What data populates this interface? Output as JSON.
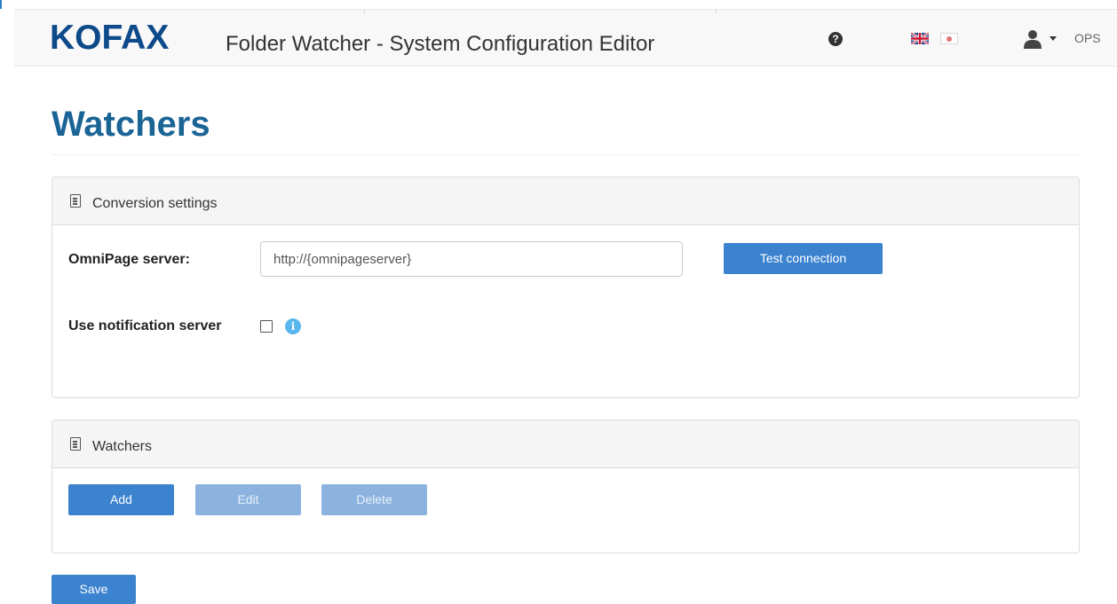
{
  "header": {
    "logo_text": "KOFAX",
    "app_title": "Folder Watcher - System Configuration Editor",
    "help_glyph": "?",
    "languages": [
      "English",
      "Japanese"
    ],
    "user_name": "OPS"
  },
  "page": {
    "title": "Watchers"
  },
  "conversion_panel": {
    "title": "Conversion settings",
    "icon": "document-icon",
    "omnipage_label": "OmniPage server:",
    "omnipage_value": "http://{omnipageserver}",
    "test_button": "Test connection",
    "notification_label": "Use notification server",
    "notification_checked": false,
    "info_glyph": "i"
  },
  "watchers_panel": {
    "title": "Watchers",
    "icon": "document-icon",
    "add_button": "Add",
    "edit_button": "Edit",
    "delete_button": "Delete"
  },
  "footer": {
    "save_button": "Save"
  },
  "colors": {
    "logo": "#0d4a8a",
    "heading": "#1a6496",
    "primary": "#3b82cf",
    "disabled": "#8cb3df",
    "info": "#5ab7ee"
  }
}
